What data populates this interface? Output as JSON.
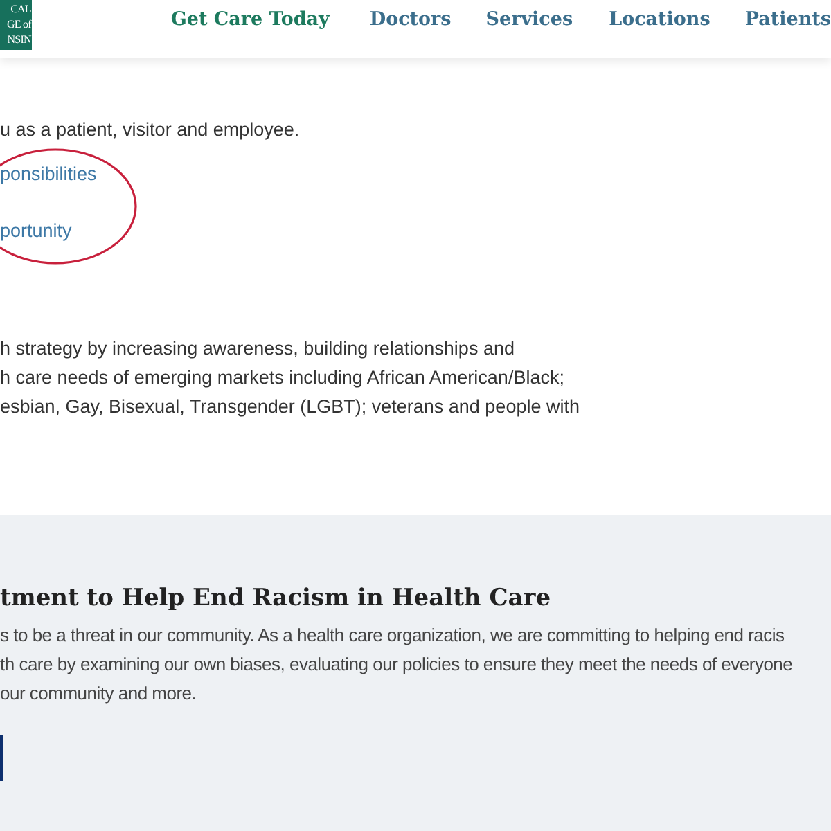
{
  "header": {
    "logo_lines": [
      "CAL",
      "GE of",
      "NSIN"
    ],
    "nav": [
      {
        "label": "Get Care Today",
        "kind": "highlight"
      },
      {
        "label": "Doctors",
        "kind": "plain"
      },
      {
        "label": "Services",
        "kind": "plain"
      },
      {
        "label": "Locations",
        "kind": "plain"
      },
      {
        "label": "Patients",
        "kind": "plain"
      }
    ]
  },
  "intro": {
    "text": "u as a patient, visitor and employee.",
    "links": [
      {
        "label": "ponsibilities",
        "circled": true
      },
      {
        "label": "portunity",
        "circled": true
      }
    ],
    "paragraph": [
      "h strategy by increasing awareness, building relationships and",
      "h care needs of emerging markets including African American/Black;",
      "esbian, Gay, Bisexual, Transgender (LGBT); veterans and people with"
    ]
  },
  "commitment": {
    "heading": "tment to Help End Racism in Health Care",
    "paragraph": [
      "s to be a threat in our community. As a health care organization, we are committing to helping end racis",
      "th care by examining our own biases, evaluating our policies to ensure they meet the needs of everyone",
      "our community and more."
    ]
  }
}
